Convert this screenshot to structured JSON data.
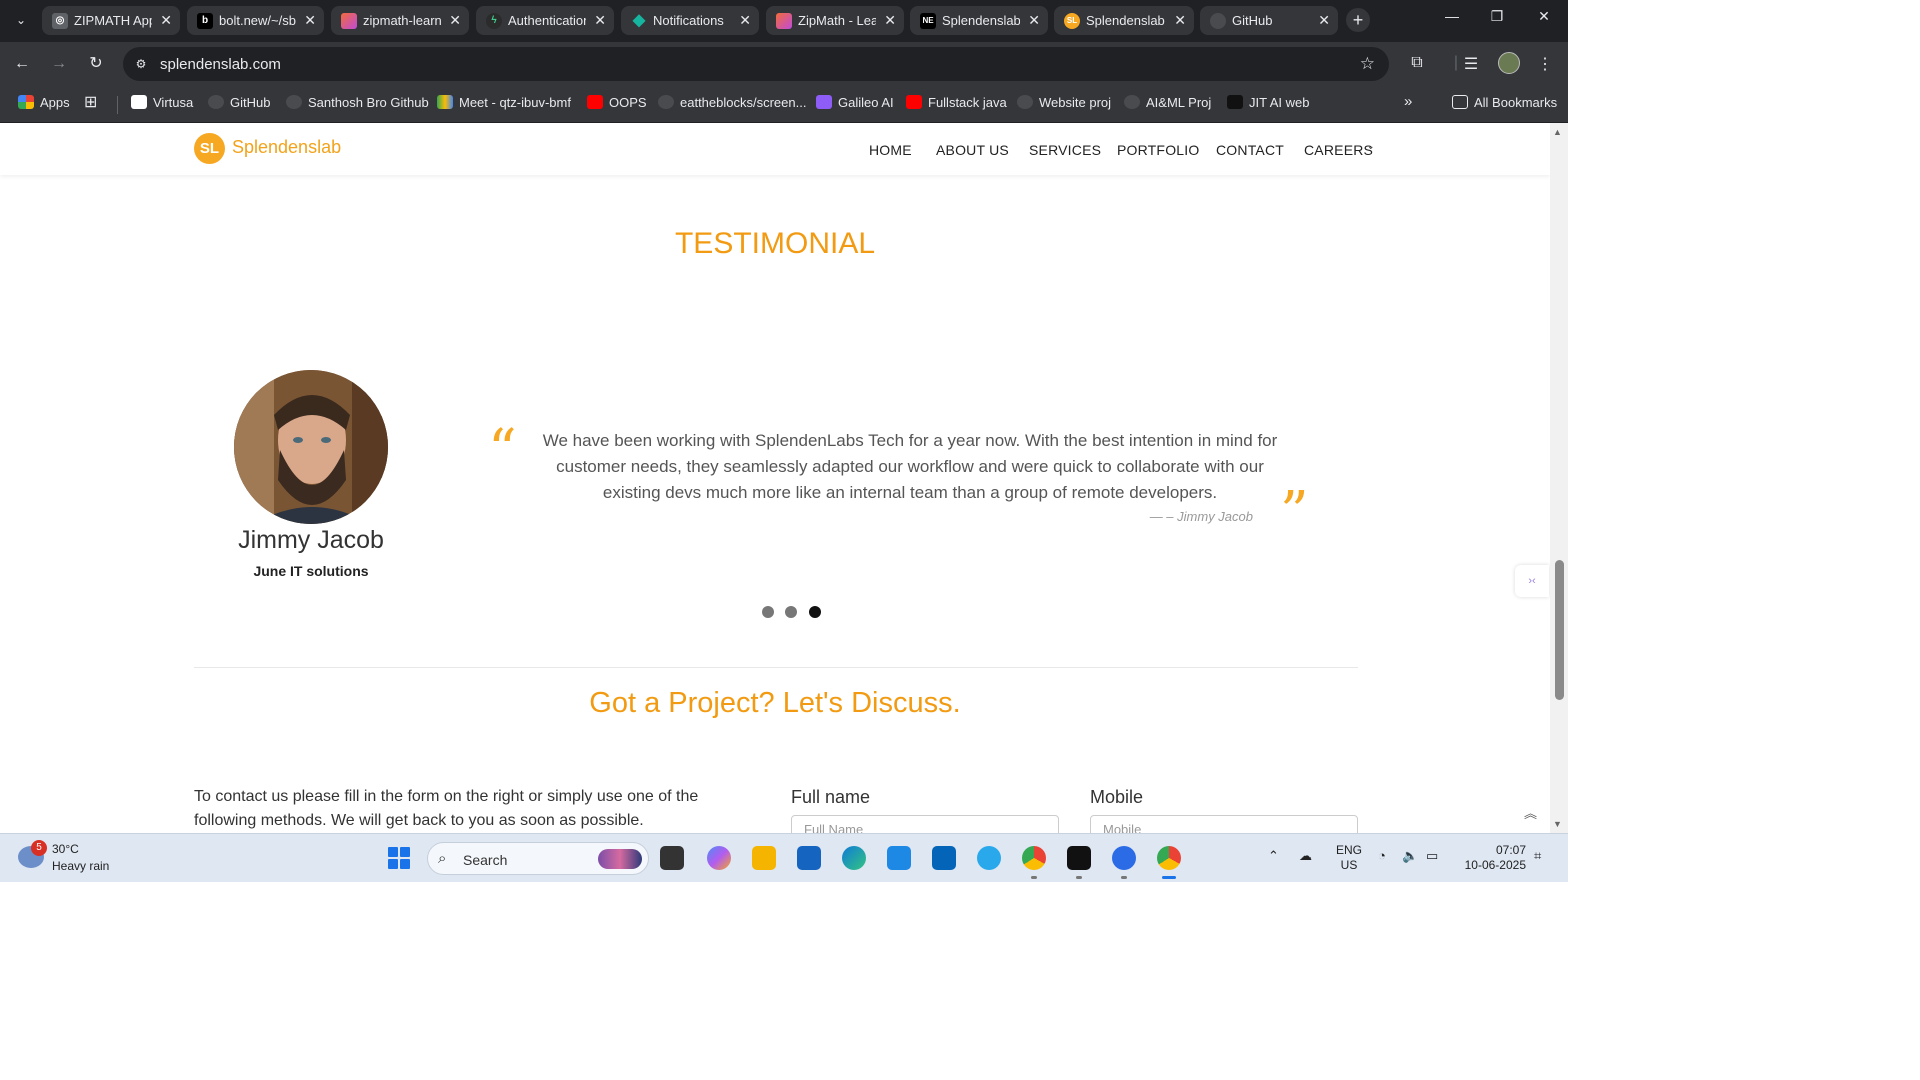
{
  "browser": {
    "tabs": [
      {
        "title": "ZIPMATH App",
        "icon": "openai-icon",
        "color": "#5f6368"
      },
      {
        "title": "bolt.new/~/sb",
        "icon": "bolt-icon",
        "color": "#202124"
      },
      {
        "title": "zipmath-learn",
        "icon": "lovable-icon",
        "color": "#e8527a"
      },
      {
        "title": "Authentication",
        "icon": "supabase-icon",
        "color": "#3ecf8e"
      },
      {
        "title": "Notifications",
        "icon": "diamond-icon",
        "color": "#16b5a0"
      },
      {
        "title": "ZipMath - Lea",
        "icon": "lovable-icon",
        "color": "#e8527a"
      },
      {
        "title": "Splendenslab",
        "icon": "vercel-icon",
        "color": "#202124"
      },
      {
        "title": "Splendenslab",
        "icon": "splendenslab-icon",
        "color": "#f7a823"
      },
      {
        "title": "GitHub",
        "icon": "github-icon",
        "color": "#5f6368"
      }
    ],
    "active_tab": 7,
    "url": "splendenslab.com",
    "bookmarks": [
      {
        "label": "Apps",
        "icon": "apps-grid-icon",
        "color": "#ea4335"
      },
      {
        "label": "Virtusa",
        "icon": "virtusa-icon",
        "color": "#ffffff"
      },
      {
        "label": "GitHub",
        "icon": "github-icon",
        "color": "#4a4b4f"
      },
      {
        "label": "Santhosh Bro Github",
        "icon": "github-icon",
        "color": "#4a4b4f"
      },
      {
        "label": "Meet - qtz-ibuv-bmf",
        "icon": "meet-icon",
        "color": "#34a853"
      },
      {
        "label": "OOPS",
        "icon": "youtube-icon",
        "color": "#ff0000"
      },
      {
        "label": "eattheblocks/screen...",
        "icon": "github-icon",
        "color": "#4a4b4f"
      },
      {
        "label": "Galileo AI",
        "icon": "galileo-icon",
        "color": "#8e5cf7"
      },
      {
        "label": "Fullstack java",
        "icon": "youtube-icon",
        "color": "#ff0000"
      },
      {
        "label": "Website proj",
        "icon": "github-icon",
        "color": "#4a4b4f"
      },
      {
        "label": "AI&ML Proj",
        "icon": "github-icon",
        "color": "#4a4b4f"
      },
      {
        "label": "JIT AI web",
        "icon": "jit-icon",
        "color": "#111111"
      }
    ],
    "all_bookmarks": "All Bookmarks"
  },
  "site": {
    "logo_mark": "SL",
    "logo_text": "Splendenslab",
    "nav": [
      "HOME",
      "ABOUT US",
      "SERVICES",
      "PORTFOLIO",
      "CONTACT",
      "CAREERS"
    ],
    "testimonial": {
      "title": "TESTIMONIAL",
      "name": "Jimmy Jacob",
      "company": "June IT solutions",
      "quote": "We have been working with SplendenLabs Tech for a year now. With the best intention in mind for customer needs, they seamlessly adapted our workflow and were quick to collaborate with our existing devs much more like an internal team than a group of remote developers.",
      "author": "— – Jimmy Jacob",
      "slides": 3,
      "active_slide": 3
    },
    "project": {
      "title": "Got a Project? Let's Discuss.",
      "text": "To contact us please fill in the form on the right or simply use one of the following methods. We will get back to you as soon as possible.",
      "full_name_label": "Full name",
      "full_name_placeholder": "Full Name",
      "mobile_label": "Mobile",
      "mobile_placeholder": "Mobile"
    }
  },
  "taskbar": {
    "weather_badge": "5",
    "temp": "30°C",
    "condition": "Heavy rain",
    "search": "Search",
    "lang_top": "ENG",
    "lang_bottom": "US",
    "time": "07:07",
    "date": "10-06-2025"
  },
  "colors": {
    "accent": "#f29b12",
    "chrome_dark": "#202124",
    "chrome_mid": "#35363a"
  }
}
